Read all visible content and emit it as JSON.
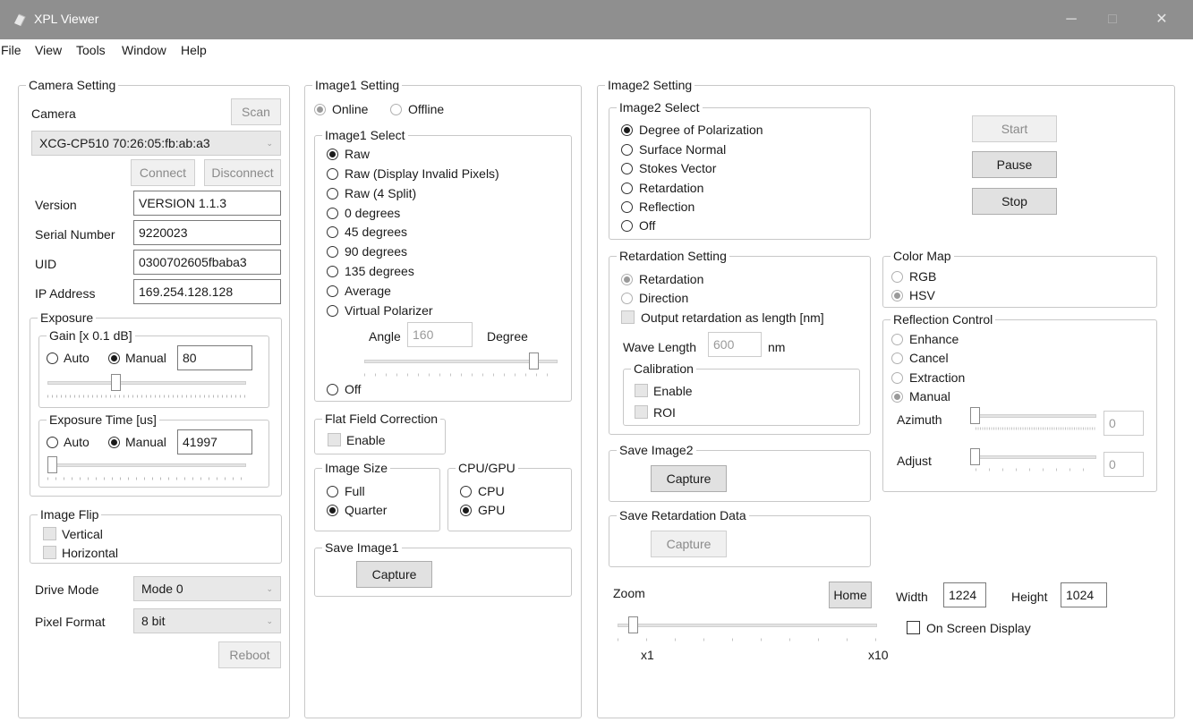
{
  "window": {
    "title": "XPL Viewer",
    "minimize": "─",
    "maximize": "□",
    "close": "✕"
  },
  "menu": [
    "File",
    "View",
    "Tools",
    "Window",
    "Help"
  ],
  "camera_setting": {
    "title": "Camera Setting",
    "camera_label": "Camera",
    "scan": "Scan",
    "camera_select": "XCG-CP510 70:26:05:fb:ab:a3",
    "connect": "Connect",
    "disconnect": "Disconnect",
    "version_label": "Version",
    "version": "VERSION 1.1.3",
    "serial_label": "Serial Number",
    "serial": "9220023",
    "uid_label": "UID",
    "uid": "0300702605fbaba3",
    "ip_label": "IP Address",
    "ip": "169.254.128.128",
    "exposure": {
      "title": "Exposure",
      "gain_title": "Gain [x 0.1 dB]",
      "auto": "Auto",
      "manual": "Manual",
      "gain_value": "80",
      "time_title": "Exposure Time [us]",
      "time_value": "41997"
    },
    "image_flip": {
      "title": "Image Flip",
      "vertical": "Vertical",
      "horizontal": "Horizontal"
    },
    "drive_mode_label": "Drive Mode",
    "drive_mode": "Mode 0",
    "pixel_format_label": "Pixel Format",
    "pixel_format": "8 bit",
    "reboot": "Reboot"
  },
  "image1_setting": {
    "title": "Image1 Setting",
    "online": "Online",
    "offline": "Offline",
    "select_title": "Image1 Select",
    "options": [
      "Raw",
      "Raw (Display Invalid Pixels)",
      "Raw (4 Split)",
      "0 degrees",
      "45 degrees",
      "90 degrees",
      "135 degrees",
      "Average",
      "Virtual Polarizer"
    ],
    "angle_label": "Angle",
    "angle_value": "160",
    "degree_label": "Degree",
    "off": "Off",
    "flat_field_title": "Flat Field Correction",
    "enable": "Enable",
    "image_size_title": "Image Size",
    "full": "Full",
    "quarter": "Quarter",
    "cpu_gpu_title": "CPU/GPU",
    "cpu": "CPU",
    "gpu": "GPU",
    "save_title": "Save Image1",
    "capture": "Capture"
  },
  "image2_setting": {
    "title": "Image2 Setting",
    "select_title": "Image2 Select",
    "options": [
      "Degree of Polarization",
      "Surface Normal",
      "Stokes Vector",
      "Retardation",
      "Reflection",
      "Off"
    ],
    "start": "Start",
    "pause": "Pause",
    "stop": "Stop",
    "retardation_title": "Retardation Setting",
    "retardation": "Retardation",
    "direction": "Direction",
    "output_length": "Output retardation as length [nm]",
    "wave_length_label": "Wave Length",
    "wave_length": "600",
    "nm": "nm",
    "calibration_title": "Calibration",
    "cal_enable": "Enable",
    "cal_roi": "ROI",
    "color_map_title": "Color Map",
    "rgb": "RGB",
    "hsv": "HSV",
    "reflection_title": "Reflection Control",
    "enhance": "Enhance",
    "cancel": "Cancel",
    "extraction": "Extraction",
    "manual": "Manual",
    "azimuth_label": "Azimuth",
    "azimuth_value": "0",
    "adjust_label": "Adjust",
    "adjust_value": "0",
    "save_image2_title": "Save Image2",
    "capture": "Capture",
    "save_ret_title": "Save Retardation Data",
    "capture2": "Capture",
    "zoom_label": "Zoom",
    "home": "Home",
    "width_label": "Width",
    "width_value": "1224",
    "height_label": "Height",
    "height_value": "1024",
    "zoom_min": "x1",
    "zoom_max": "x10",
    "osd": "On Screen Display"
  }
}
